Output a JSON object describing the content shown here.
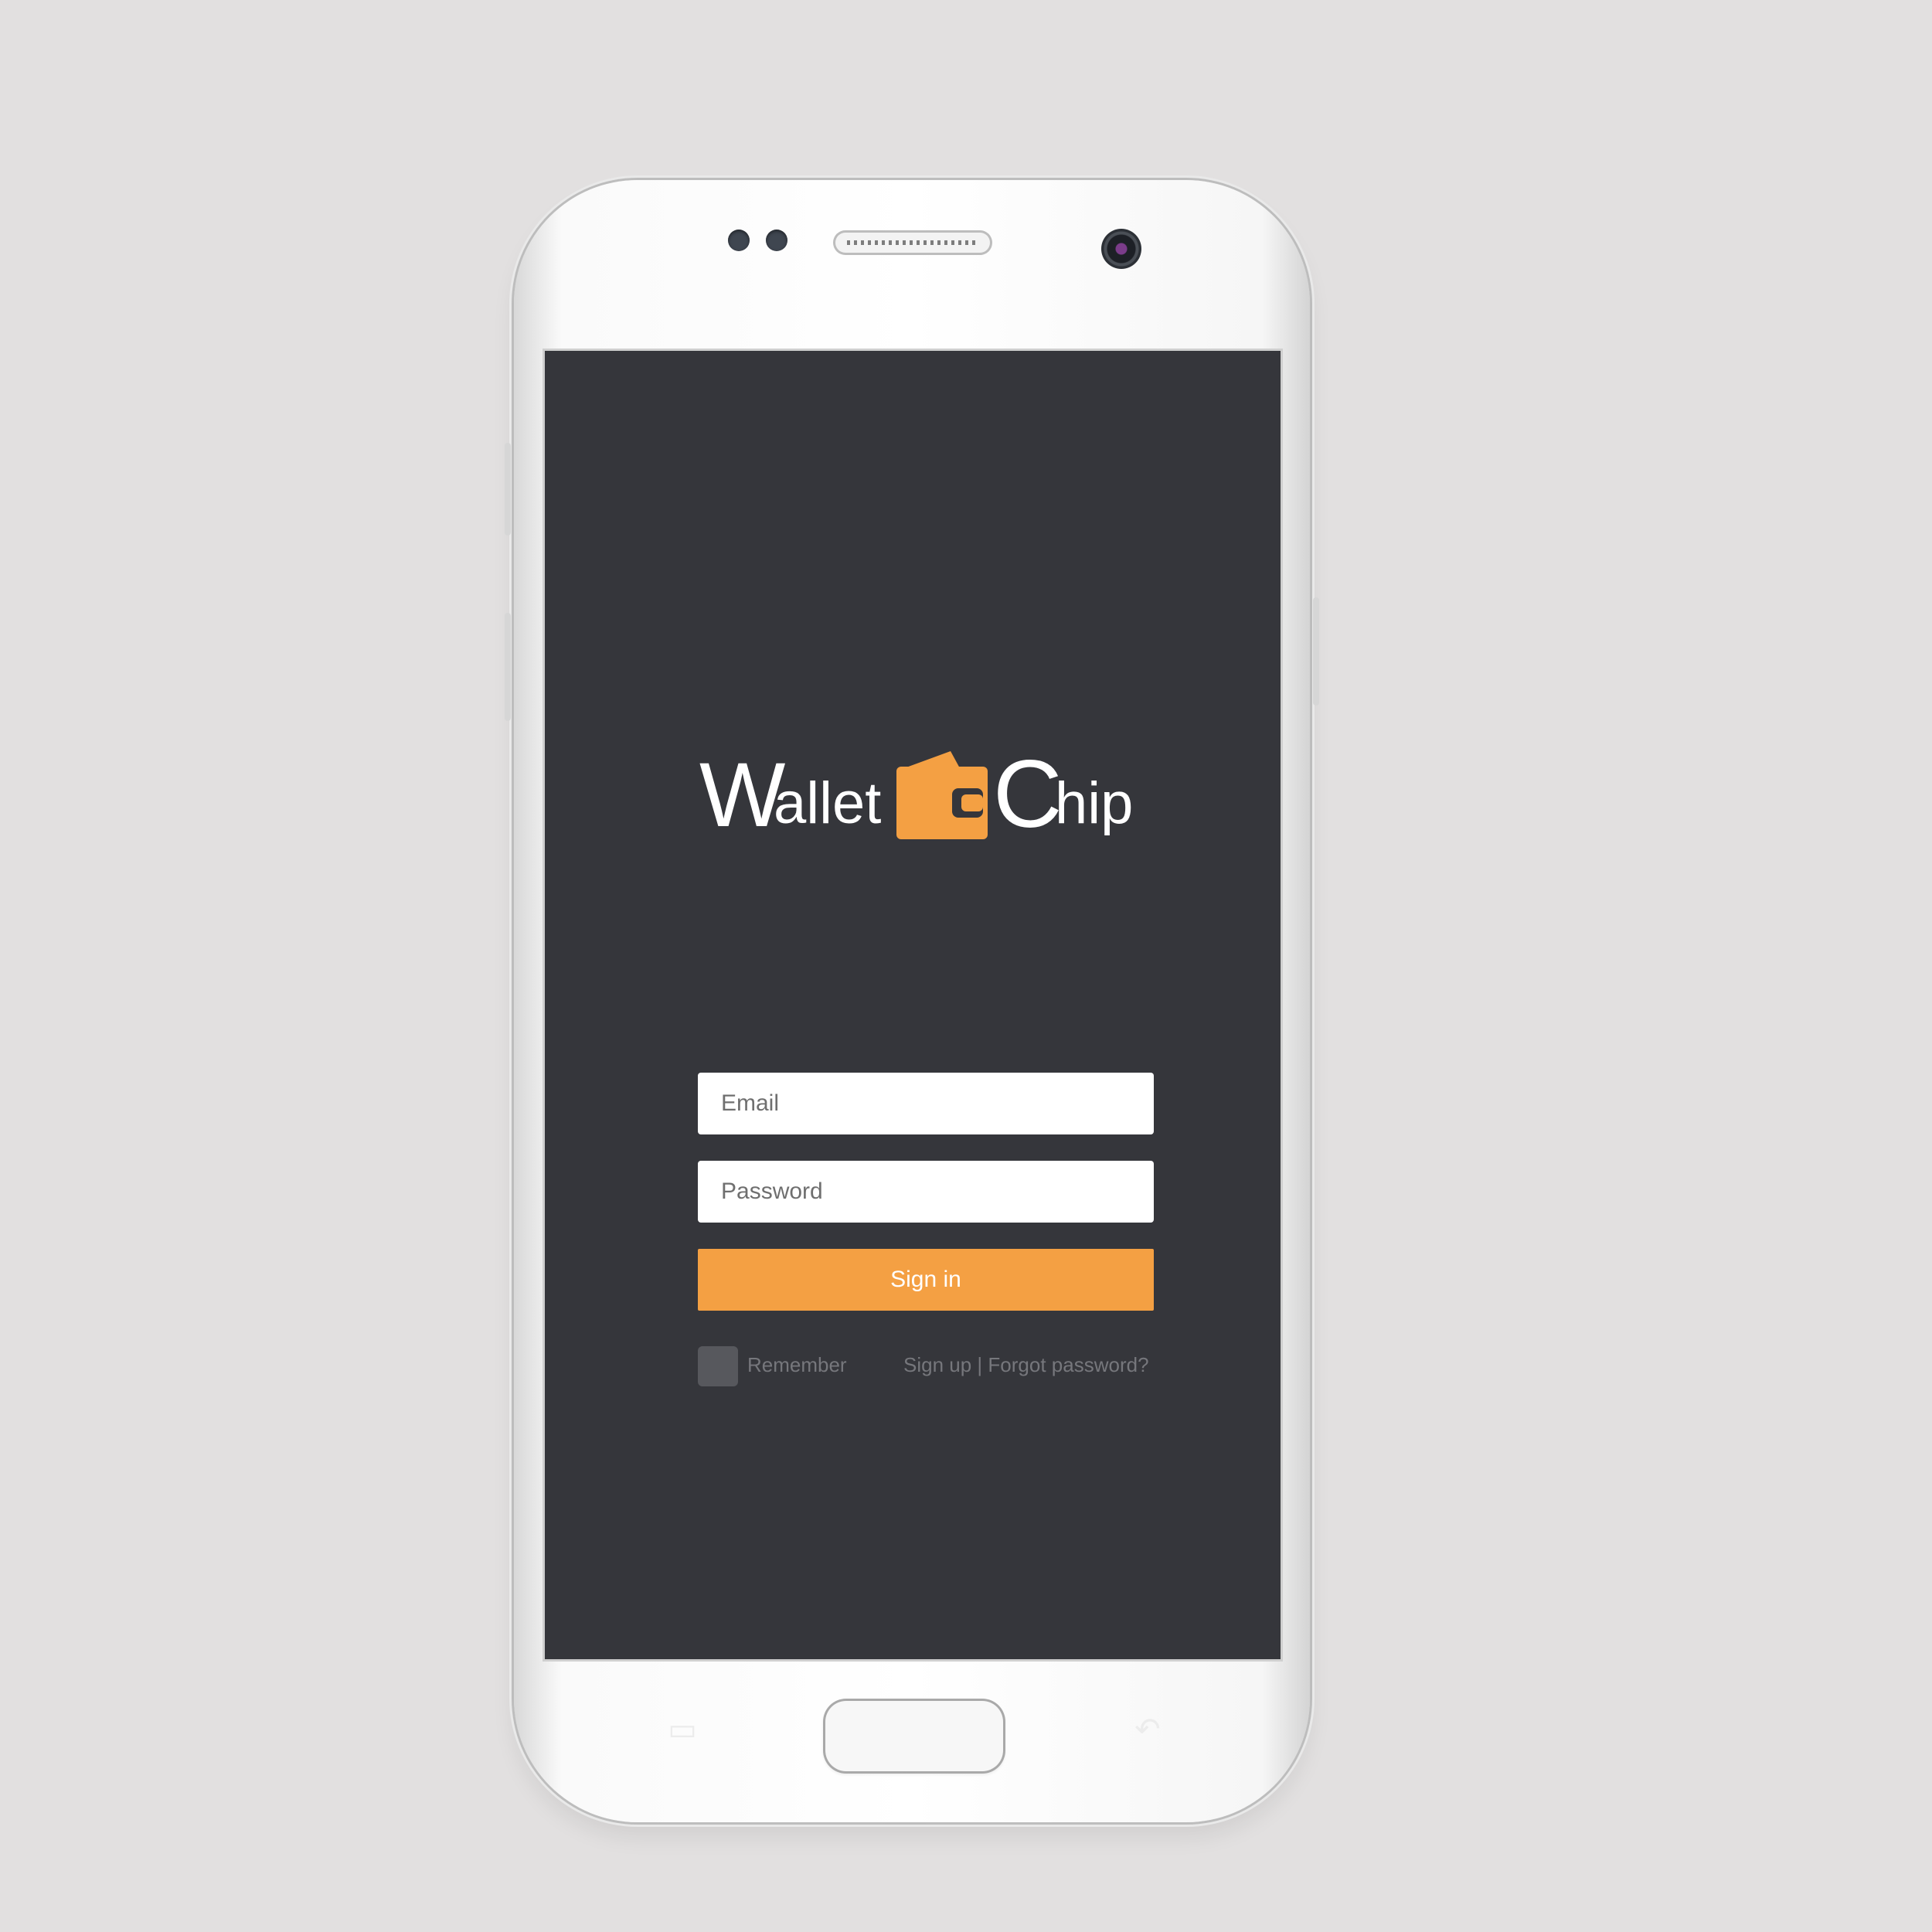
{
  "logo": {
    "word1_initial": "W",
    "word1_rest": "allet",
    "word2_initial": "C",
    "word2_rest": "hip",
    "accent": "#f4a043",
    "icon": "wallet-icon"
  },
  "form": {
    "email_placeholder": "Email",
    "password_placeholder": "Password",
    "signin_label": "Sign in",
    "remember_label": "Remember",
    "signup_label": "Sign up",
    "separator": "|",
    "forgot_label": "Forgot password?"
  },
  "colors": {
    "screen_background": "#35363b",
    "button": "#f4a043",
    "page_background": "#e2e0e0"
  },
  "device": {
    "home_button": "home-button",
    "recent_apps_icon": "recent-apps-icon",
    "back_icon": "back-icon"
  }
}
